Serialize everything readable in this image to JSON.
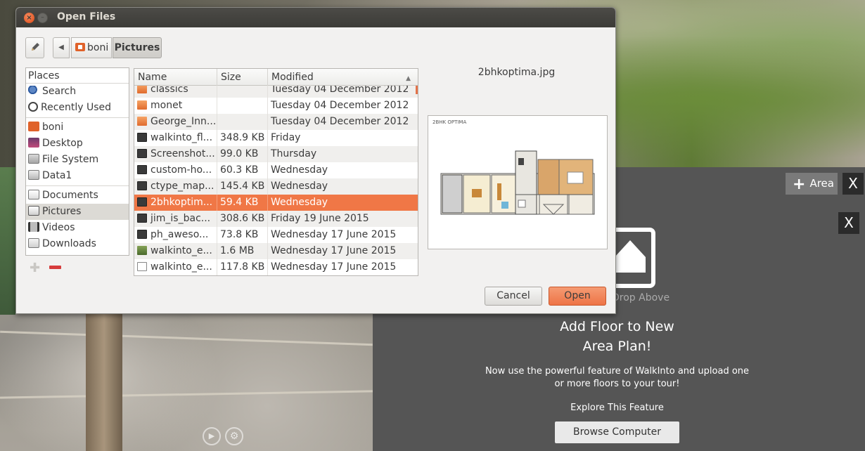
{
  "dialog": {
    "title": "Open Files",
    "close_symbol": "×",
    "minimize_symbol": "–",
    "edit_icon": "pencil-icon",
    "breadcrumbs": [
      "boni",
      "Pictures"
    ],
    "places": {
      "header": "Places",
      "items": [
        {
          "label": "Search",
          "icon": "search-icon"
        },
        {
          "label": "Recently Used",
          "icon": "clock-icon"
        },
        {
          "label": "boni",
          "icon": "home-folder-icon"
        },
        {
          "label": "Desktop",
          "icon": "desktop-icon"
        },
        {
          "label": "File System",
          "icon": "filesystem-icon"
        },
        {
          "label": "Data1",
          "icon": "drive-icon"
        },
        {
          "label": "Documents",
          "icon": "documents-icon"
        },
        {
          "label": "Pictures",
          "icon": "pictures-icon"
        },
        {
          "label": "Videos",
          "icon": "videos-icon"
        },
        {
          "label": "Downloads",
          "icon": "downloads-icon"
        }
      ],
      "add_symbol": "✚"
    },
    "columns": {
      "name": "Name",
      "size": "Size",
      "modified": "Modified"
    },
    "files": [
      {
        "name": "classics",
        "size": "",
        "modified": "Tuesday 04 December 2012",
        "type": "folder"
      },
      {
        "name": "monet",
        "size": "",
        "modified": "Tuesday 04 December 2012",
        "type": "folder"
      },
      {
        "name": "George_Inn...",
        "size": "",
        "modified": "Tuesday 04 December 2012",
        "type": "folder"
      },
      {
        "name": "walkinto_fl...",
        "size": "348.9 KB",
        "modified": "Friday",
        "type": "image"
      },
      {
        "name": "Screenshot...",
        "size": "99.0 KB",
        "modified": "Thursday",
        "type": "image"
      },
      {
        "name": "custom-ho...",
        "size": "60.3 KB",
        "modified": "Wednesday",
        "type": "image"
      },
      {
        "name": "ctype_map...",
        "size": "145.4 KB",
        "modified": "Wednesday",
        "type": "image"
      },
      {
        "name": "2bhkoptim...",
        "size": "59.4 KB",
        "modified": "Wednesday",
        "type": "image"
      },
      {
        "name": "jim_is_bac...",
        "size": "308.6 KB",
        "modified": "Friday 19 June 2015",
        "type": "image"
      },
      {
        "name": "ph_aweso...",
        "size": "73.8 KB",
        "modified": "Wednesday 17 June 2015",
        "type": "image"
      },
      {
        "name": "walkinto_e...",
        "size": "1.6 MB",
        "modified": "Wednesday 17 June 2015",
        "type": "photo"
      },
      {
        "name": "walkinto_e...",
        "size": "117.8 KB",
        "modified": "Wednesday 17 June 2015",
        "type": "doc"
      }
    ],
    "preview": {
      "filename": "2bhkoptima.jpg",
      "caption": "2BHK OPTIMA"
    },
    "cancel_label": "Cancel",
    "open_label": "Open"
  },
  "app": {
    "area_button_label": "Area",
    "close_symbol": "X",
    "drop_above": "Drop Above",
    "feature_title_line1": "Add Floor to New",
    "feature_title_line2": "Area Plan!",
    "feature_desc_line1": "Now use the powerful feature of WalkInto and upload one",
    "feature_desc_line2": "or more floors to your tour!",
    "explore": "Explore This Feature",
    "browse_label": "Browse Computer"
  },
  "colors": {
    "accent": "#f07746",
    "panel": "#555555",
    "titlebar": "#3c3b37"
  }
}
